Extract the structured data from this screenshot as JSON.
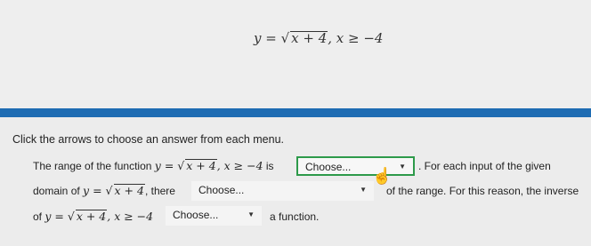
{
  "equation": {
    "text": "y = √x + 4, x ≥ −4",
    "lhs": "y =",
    "radicand": "x + 4",
    "domain": ", x ≥ −4"
  },
  "instruction": "Click the arrows to choose an answer from each menu.",
  "question": {
    "line1_prefix": "The range of the function",
    "line1_func_lhs": "y =",
    "line1_radicand": "x + 4",
    "line1_domain": ", x ≥ −4",
    "line1_is": "is",
    "line1_suffix": ". For each input of the given",
    "line2_prefix": "domain of",
    "line2_func_lhs": "y =",
    "line2_radicand": "x + 4",
    "line2_mid": ", there",
    "line2_suffix": "of the range. For this reason, the inverse",
    "line3_prefix": "of",
    "line3_func_lhs": "y =",
    "line3_radicand": "x + 4",
    "line3_domain": ", x ≥ −4",
    "line3_suffix": "a function."
  },
  "dropdowns": [
    {
      "value": "Choose...",
      "active": true
    },
    {
      "value": "Choose...",
      "active": false
    },
    {
      "value": "Choose...",
      "active": false
    }
  ],
  "colors": {
    "accent_bar": "#1e6cb3",
    "active_border": "#2d9a4a"
  },
  "icons": {
    "caret": "chevron-down-icon",
    "cursor": "hand-pointer-icon"
  }
}
